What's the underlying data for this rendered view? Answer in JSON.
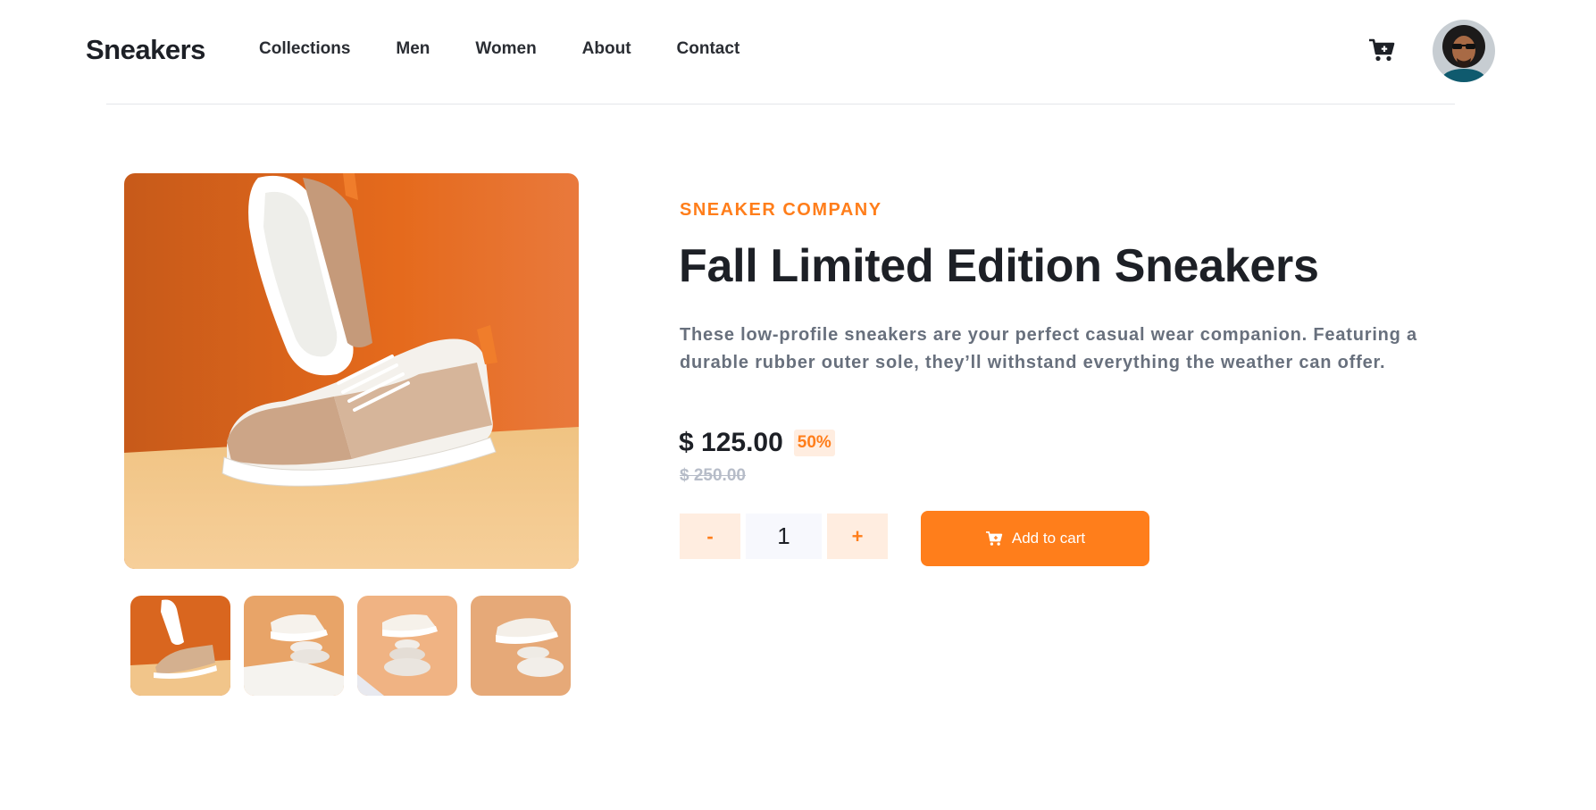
{
  "header": {
    "logo": "Sneakers",
    "nav": [
      "Collections",
      "Men",
      "Women",
      "About",
      "Contact"
    ],
    "cart_icon": "cart-icon",
    "avatar_icon": "avatar"
  },
  "product": {
    "company": "SNEAKER COMPANY",
    "title": "Fall Limited Edition Sneakers",
    "description": "These low-profile sneakers are your perfect casual wear companion. Featuring a durable rubber outer sole, they’ll withstand everything the weather can offer.",
    "price": "$ 125.00",
    "discount": "50%",
    "old_price": "$ 250.00"
  },
  "cart": {
    "decrement": "-",
    "quantity": "1",
    "increment": "+",
    "add_label": "Add to cart"
  },
  "colors": {
    "accent": "#ff7e1b",
    "accent_pale": "#ffede0",
    "dark": "#1d2026",
    "muted": "#68707d",
    "strike": "#b6bcc8"
  }
}
